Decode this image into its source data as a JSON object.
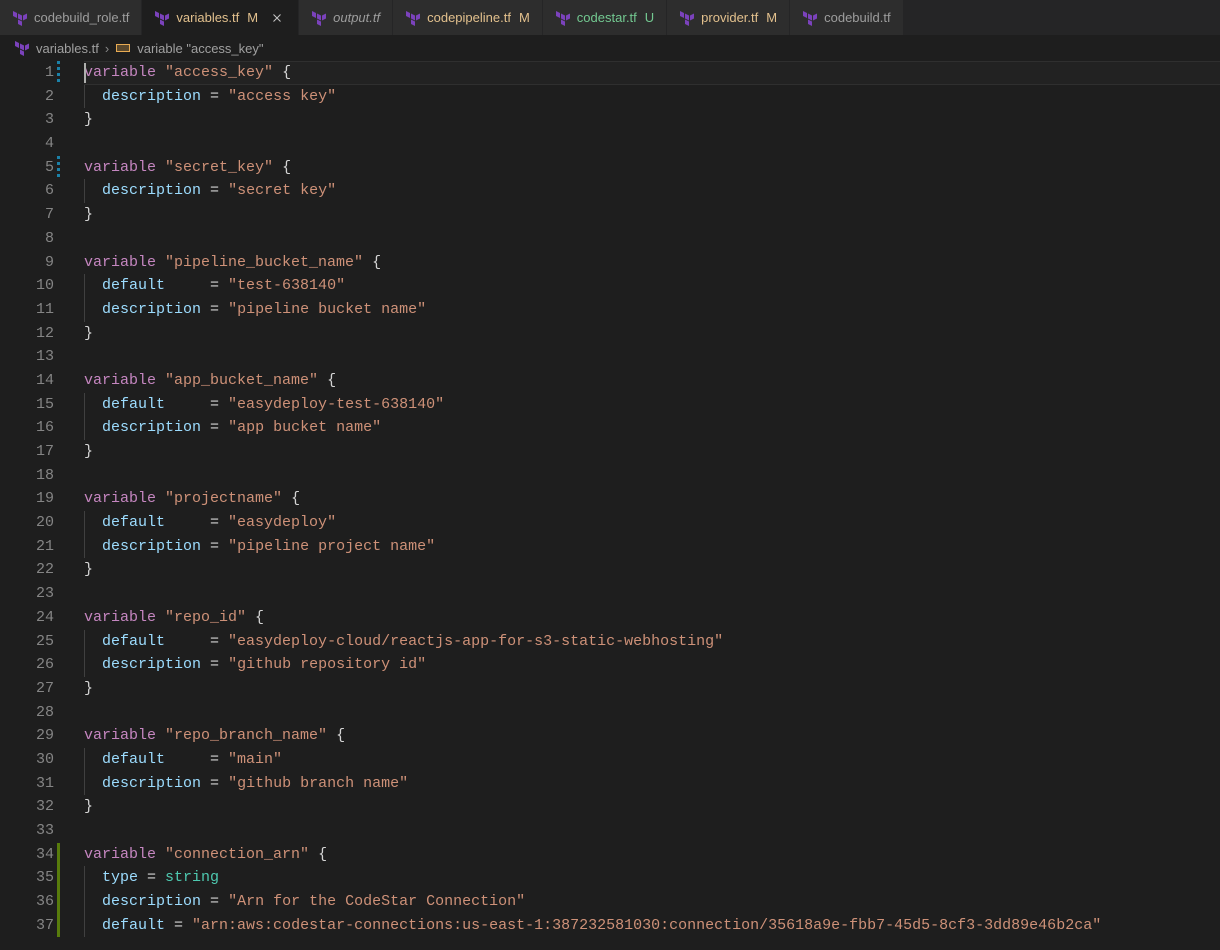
{
  "tabs": [
    {
      "label": "codebuild_role.tf",
      "status": "",
      "active": false,
      "italic": false,
      "close": false
    },
    {
      "label": "variables.tf",
      "status": "M",
      "active": true,
      "italic": false,
      "close": true
    },
    {
      "label": "output.tf",
      "status": "",
      "active": false,
      "italic": true,
      "close": false
    },
    {
      "label": "codepipeline.tf",
      "status": "M",
      "active": false,
      "italic": false,
      "close": false
    },
    {
      "label": "codestar.tf",
      "status": "U",
      "active": false,
      "italic": false,
      "close": false
    },
    {
      "label": "provider.tf",
      "status": "M",
      "active": false,
      "italic": false,
      "close": false
    },
    {
      "label": "codebuild.tf",
      "status": "",
      "active": false,
      "italic": false,
      "close": false
    }
  ],
  "breadcrumbs": {
    "file": "variables.tf",
    "symbol": "variable \"access_key\""
  },
  "code": {
    "lines": [
      {
        "n": 1,
        "git": "modified",
        "cursor": true,
        "tokens": [
          [
            "kw",
            "variable"
          ],
          [
            "punc",
            " "
          ],
          [
            "str",
            "\"access_key\""
          ],
          [
            "punc",
            " {"
          ]
        ]
      },
      {
        "n": 2,
        "indent": 1,
        "tokens": [
          [
            "prop",
            "description"
          ],
          [
            "punc",
            " = "
          ],
          [
            "str",
            "\"access key\""
          ]
        ]
      },
      {
        "n": 3,
        "tokens": [
          [
            "punc",
            "}"
          ]
        ]
      },
      {
        "n": 4,
        "tokens": []
      },
      {
        "n": 5,
        "git": "modified",
        "tokens": [
          [
            "kw",
            "variable"
          ],
          [
            "punc",
            " "
          ],
          [
            "str",
            "\"secret_key\""
          ],
          [
            "punc",
            " {"
          ]
        ]
      },
      {
        "n": 6,
        "indent": 1,
        "tokens": [
          [
            "prop",
            "description"
          ],
          [
            "punc",
            " = "
          ],
          [
            "str",
            "\"secret key\""
          ]
        ]
      },
      {
        "n": 7,
        "tokens": [
          [
            "punc",
            "}"
          ]
        ]
      },
      {
        "n": 8,
        "tokens": []
      },
      {
        "n": 9,
        "tokens": [
          [
            "kw",
            "variable"
          ],
          [
            "punc",
            " "
          ],
          [
            "str",
            "\"pipeline_bucket_name\""
          ],
          [
            "punc",
            " {"
          ]
        ]
      },
      {
        "n": 10,
        "indent": 1,
        "tokens": [
          [
            "prop",
            "default"
          ],
          [
            "punc",
            "     = "
          ],
          [
            "str",
            "\"test-638140\""
          ]
        ]
      },
      {
        "n": 11,
        "indent": 1,
        "tokens": [
          [
            "prop",
            "description"
          ],
          [
            "punc",
            " = "
          ],
          [
            "str",
            "\"pipeline bucket name\""
          ]
        ]
      },
      {
        "n": 12,
        "tokens": [
          [
            "punc",
            "}"
          ]
        ]
      },
      {
        "n": 13,
        "tokens": []
      },
      {
        "n": 14,
        "tokens": [
          [
            "kw",
            "variable"
          ],
          [
            "punc",
            " "
          ],
          [
            "str",
            "\"app_bucket_name\""
          ],
          [
            "punc",
            " {"
          ]
        ]
      },
      {
        "n": 15,
        "indent": 1,
        "tokens": [
          [
            "prop",
            "default"
          ],
          [
            "punc",
            "     = "
          ],
          [
            "str",
            "\"easydeploy-test-638140\""
          ]
        ]
      },
      {
        "n": 16,
        "indent": 1,
        "tokens": [
          [
            "prop",
            "description"
          ],
          [
            "punc",
            " = "
          ],
          [
            "str",
            "\"app bucket name\""
          ]
        ]
      },
      {
        "n": 17,
        "tokens": [
          [
            "punc",
            "}"
          ]
        ]
      },
      {
        "n": 18,
        "tokens": []
      },
      {
        "n": 19,
        "tokens": [
          [
            "kw",
            "variable"
          ],
          [
            "punc",
            " "
          ],
          [
            "str",
            "\"projectname\""
          ],
          [
            "punc",
            " {"
          ]
        ]
      },
      {
        "n": 20,
        "indent": 1,
        "tokens": [
          [
            "prop",
            "default"
          ],
          [
            "punc",
            "     = "
          ],
          [
            "str",
            "\"easydeploy\""
          ]
        ]
      },
      {
        "n": 21,
        "indent": 1,
        "tokens": [
          [
            "prop",
            "description"
          ],
          [
            "punc",
            " = "
          ],
          [
            "str",
            "\"pipeline project name\""
          ]
        ]
      },
      {
        "n": 22,
        "tokens": [
          [
            "punc",
            "}"
          ]
        ]
      },
      {
        "n": 23,
        "tokens": []
      },
      {
        "n": 24,
        "tokens": [
          [
            "kw",
            "variable"
          ],
          [
            "punc",
            " "
          ],
          [
            "str",
            "\"repo_id\""
          ],
          [
            "punc",
            " {"
          ]
        ]
      },
      {
        "n": 25,
        "indent": 1,
        "tokens": [
          [
            "prop",
            "default"
          ],
          [
            "punc",
            "     = "
          ],
          [
            "str",
            "\"easydeploy-cloud/reactjs-app-for-s3-static-webhosting\""
          ]
        ]
      },
      {
        "n": 26,
        "indent": 1,
        "tokens": [
          [
            "prop",
            "description"
          ],
          [
            "punc",
            " = "
          ],
          [
            "str",
            "\"github repository id\""
          ]
        ]
      },
      {
        "n": 27,
        "tokens": [
          [
            "punc",
            "}"
          ]
        ]
      },
      {
        "n": 28,
        "tokens": []
      },
      {
        "n": 29,
        "tokens": [
          [
            "kw",
            "variable"
          ],
          [
            "punc",
            " "
          ],
          [
            "str",
            "\"repo_branch_name\""
          ],
          [
            "punc",
            " {"
          ]
        ]
      },
      {
        "n": 30,
        "indent": 1,
        "tokens": [
          [
            "prop",
            "default"
          ],
          [
            "punc",
            "     = "
          ],
          [
            "str",
            "\"main\""
          ]
        ]
      },
      {
        "n": 31,
        "indent": 1,
        "tokens": [
          [
            "prop",
            "description"
          ],
          [
            "punc",
            " = "
          ],
          [
            "str",
            "\"github branch name\""
          ]
        ]
      },
      {
        "n": 32,
        "tokens": [
          [
            "punc",
            "}"
          ]
        ]
      },
      {
        "n": 33,
        "tokens": []
      },
      {
        "n": 34,
        "git": "added",
        "tokens": [
          [
            "kw",
            "variable"
          ],
          [
            "punc",
            " "
          ],
          [
            "str",
            "\"connection_arn\""
          ],
          [
            "punc",
            " {"
          ]
        ]
      },
      {
        "n": 35,
        "git": "added",
        "indent": 1,
        "tokens": [
          [
            "prop",
            "type"
          ],
          [
            "punc",
            " = "
          ],
          [
            "type",
            "string"
          ]
        ]
      },
      {
        "n": 36,
        "git": "added",
        "indent": 1,
        "tokens": [
          [
            "prop",
            "description"
          ],
          [
            "punc",
            " = "
          ],
          [
            "str",
            "\"Arn for the CodeStar Connection\""
          ]
        ]
      },
      {
        "n": 37,
        "git": "added",
        "indent": 1,
        "tokens": [
          [
            "prop",
            "default"
          ],
          [
            "punc",
            " = "
          ],
          [
            "str",
            "\"arn:aws:codestar-connections:us-east-1:387232581030:connection/35618a9e-fbb7-45d5-8cf3-3dd89e46b2ca\""
          ]
        ]
      }
    ]
  }
}
